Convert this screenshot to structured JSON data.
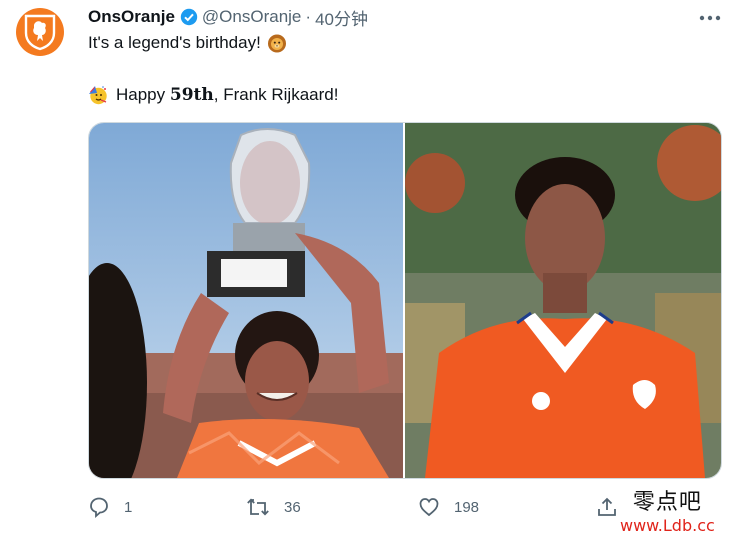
{
  "tweet": {
    "display_name": "OnsOranje",
    "handle": "@OnsOranje",
    "separator": "·",
    "time": "40分钟",
    "line1": "It's a legend's birthday!",
    "line1_emoji": "lion-face",
    "line2_emoji": "partying-face",
    "line2_prefix": "Happy ",
    "line2_bold": "59th",
    "line2_suffix": ", Frank Rijkaard!"
  },
  "media": {
    "left_photo": "player-holding-trophy-photo",
    "right_photo": "player-portrait-orange-kit-photo"
  },
  "actions": {
    "reply_count": "1",
    "retweet_count": "36",
    "like_count": "198"
  },
  "watermark": {
    "line1": "零点吧",
    "line2": "www.Ldb.cc"
  },
  "colors": {
    "brand_orange": "#f47a1f",
    "verified_blue": "#1d9bf0",
    "secondary_text": "#536471",
    "watermark_red": "#e0241b"
  }
}
